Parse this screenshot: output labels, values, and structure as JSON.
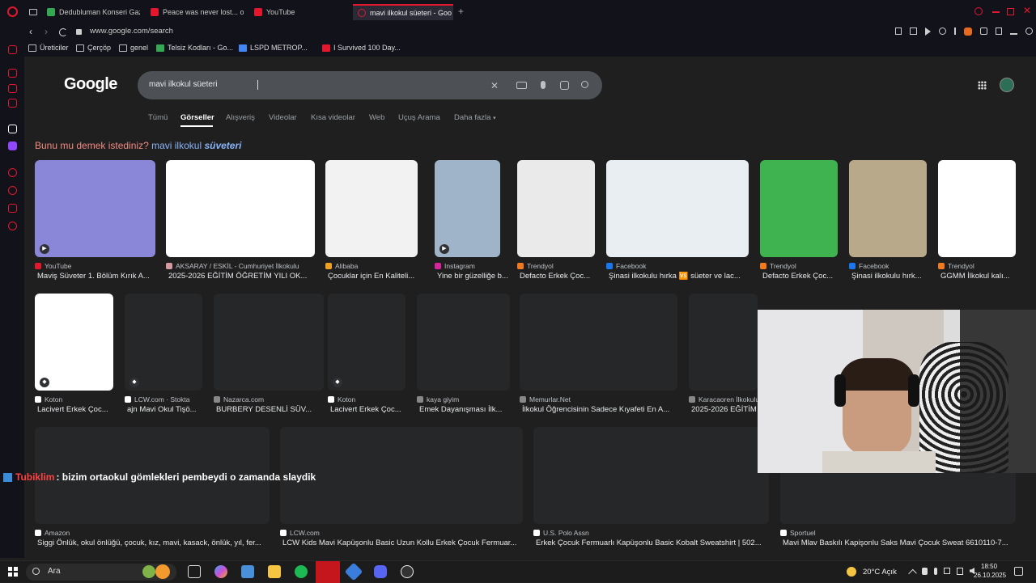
{
  "browser": {
    "tabs": [
      {
        "label": "Dedubluman Konseri Gaz",
        "color": "#34a853"
      },
      {
        "label": "Peace was never lost... on",
        "color": "#e1182e"
      },
      {
        "label": "YouTube",
        "color": "#e1182e"
      },
      {
        "label": "mavi ilkokul süeteri - Goo",
        "color": "#e1182e",
        "active": true
      }
    ],
    "url": "www.google.com/search",
    "bookmarks": [
      "Üreticiler",
      "Çerçöp",
      "genel",
      "Telsiz Kodları - Go...",
      "LSPD METROP...",
      "I Survived 100 Day..."
    ]
  },
  "google": {
    "logo": "Google",
    "query": "mavi ilkokul süeteri",
    "nav_tabs": [
      "Tümü",
      "Görseller",
      "Alışveriş",
      "Videolar",
      "Kısa videolar",
      "Web",
      "Uçuş Arama",
      "Daha fazla"
    ],
    "suggestion_prefix": "Bunu mu demek istediniz?",
    "suggestion_link": "mavi ilkokul",
    "suggestion_em": "süveteri"
  },
  "row1": [
    {
      "source": "YouTube",
      "title": "Maviş Süveter 1. Bölüm Kırık A...",
      "src_color": "#e1182e",
      "thumb": "#8a86d8"
    },
    {
      "source": "AKSARAY / ESKİL - Cumhuriyet İlkokulu",
      "title": "2025-2026 EĞİTİM ÖĞRETİM YILI OK...",
      "src_color": "#d49aa0",
      "thumb": "#ffffff"
    },
    {
      "source": "Alibaba",
      "title": "Çocuklar için En Kaliteli...",
      "src_color": "#f0a020",
      "thumb": "#f2f2f2"
    },
    {
      "source": "Instagram",
      "title": "Yine bir güzelliğe b...",
      "src_color": "#d6249f",
      "thumb": "#9fb4c8"
    },
    {
      "source": "Trendyol",
      "title": "Defacto Erkek Çoc...",
      "src_color": "#f27a1a",
      "thumb": "#eaeaea"
    },
    {
      "source": "Facebook",
      "title": "Şinasi ilkokulu hırka 🆚 süeter ve lac...",
      "src_color": "#1877f2",
      "thumb": "#e9eef2"
    },
    {
      "source": "Trendyol",
      "title": "Defacto Erkek Çoc...",
      "src_color": "#f27a1a",
      "thumb": "#3fb34f"
    },
    {
      "source": "Facebook",
      "title": "Şinasi ilkokulu hırk...",
      "src_color": "#1877f2",
      "thumb": "#b8a98a"
    },
    {
      "source": "Trendyol",
      "title": "GGMM İlkokul kalı...",
      "src_color": "#f27a1a",
      "thumb": "#ffffff"
    }
  ],
  "row2": [
    {
      "source": "Koton",
      "title": "Lacivert Erkek Çoc...",
      "src_color": "#ffffff"
    },
    {
      "source": "LCW.com · Stokta",
      "title": "ajn Mavi Okul Tişö...",
      "src_color": "#ffffff"
    },
    {
      "source": "Nazarca.com",
      "title": "BURBERY DESENLİ SÜV...",
      "src_color": "#888888"
    },
    {
      "source": "Koton",
      "title": "Lacivert Erkek Çoc...",
      "src_color": "#ffffff"
    },
    {
      "source": "kaya giyim",
      "title": "Emek Dayanışması İlk...",
      "src_color": "#888888"
    },
    {
      "source": "Memurlar.Net",
      "title": "İlkokul Öğrencisinin Sadece Kıyafeti En A...",
      "src_color": "#888888"
    },
    {
      "source": "Karacaoren İlkokulu",
      "title": "2025-2026 EĞİTİM",
      "src_color": "#888888"
    }
  ],
  "row3": [
    {
      "source": "Amazon",
      "title": "Siggi Önlük, okul önlüğü, çocuk, kız, mavi, kasack, önlük, yıl, fer..."
    },
    {
      "source": "LCW.com",
      "title": "LCW Kids Mavi Kapüşonlu Basic Uzun Kollu Erkek Çocuk Fermuar..."
    },
    {
      "source": "U.S. Polo Assn",
      "title": "Erkek Çocuk Fermuarlı Kapüşonlu Basic Kobalt Sweatshirt | 502..."
    },
    {
      "source": "Sportuel",
      "title": "Mavi Mlav Baskılı Kapişonlu Saks Mavi Çocuk Sweat 6610110-7..."
    }
  ],
  "chat": {
    "user": "Tubiklim",
    "message": ": bizim ortaokul gömlekleri pembeydi o zamanda slaydik"
  },
  "taskbar": {
    "search": "Ara",
    "weather": "20°C Açık",
    "time": "18:50",
    "date": "26.10.2025"
  }
}
